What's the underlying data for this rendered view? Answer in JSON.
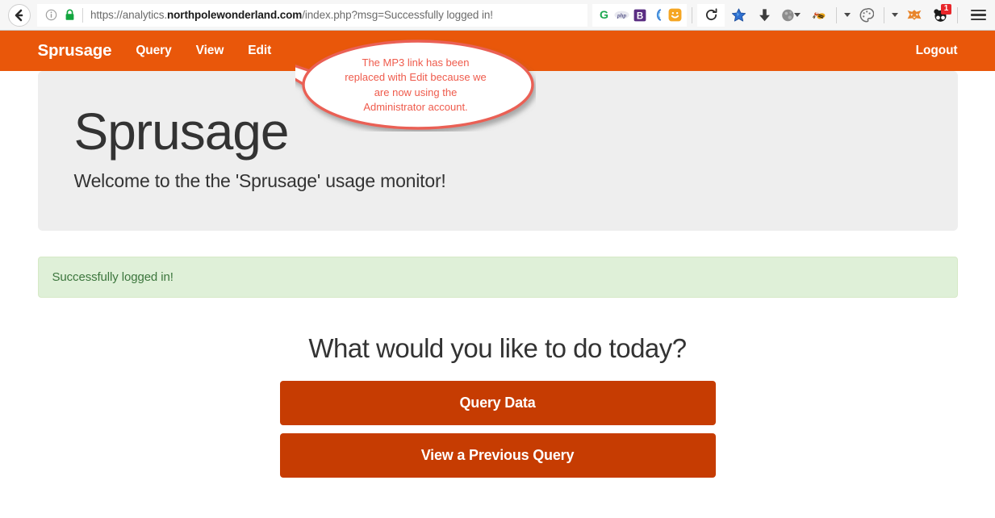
{
  "browser": {
    "back_icon": "back-arrow-icon",
    "info_icon": "site-info-icon",
    "lock_icon": "https-lock-icon",
    "url_protocol": "https://analytics.",
    "url_host_strong": "northpolewonderland.com",
    "url_path": "/index.php?msg=Successfully logged in!",
    "url_full": "https://analytics.northpolewonderland.com/index.php?msg=Successfully logged in!",
    "extensions": [
      {
        "name": "ghostery-icon",
        "glyph": "G"
      },
      {
        "name": "php-icon",
        "glyph": "php"
      },
      {
        "name": "bitwarden-icon",
        "glyph": "B"
      },
      {
        "name": "swirl-icon",
        "glyph": "("
      },
      {
        "name": "smiley-icon",
        "glyph": "ὤ2"
      }
    ],
    "reload_icon": "reload-icon",
    "toolbar_icons": [
      {
        "name": "pocket-star-icon"
      },
      {
        "name": "download-arrow-icon"
      },
      {
        "name": "globe-icon"
      },
      {
        "name": "wasp-icon"
      },
      {
        "name": "palette-icon"
      },
      {
        "name": "fox-icon"
      },
      {
        "name": "panda-icon"
      }
    ],
    "badge_count": "1",
    "menu_icon": "hamburger-menu-icon"
  },
  "nav": {
    "brand": "Sprusage",
    "links": [
      {
        "label": "Query"
      },
      {
        "label": "View"
      },
      {
        "label": "Edit"
      }
    ],
    "logout_label": "Logout"
  },
  "jumbotron": {
    "title": "Sprusage",
    "subtitle": "Welcome to the the 'Sprusage' usage monitor!"
  },
  "alert": {
    "message": "Successfully logged in!"
  },
  "cta": {
    "title": "What would you like to do today?",
    "buttons": [
      {
        "label": "Query Data"
      },
      {
        "label": "View a Previous Query"
      }
    ]
  },
  "annotation": {
    "line1": "The MP3 link has been",
    "line2": "replaced with Edit because we",
    "line3": "are now using the",
    "line4": "Administrator account.",
    "color": "#ef5b4c"
  },
  "colors": {
    "nav_orange": "#e9570a",
    "button_orange": "#c63c02",
    "jumbotron_gray": "#eeeeee",
    "alert_bg": "#dff0d8",
    "alert_text": "#3c763d",
    "badge_red": "#e8262a"
  }
}
